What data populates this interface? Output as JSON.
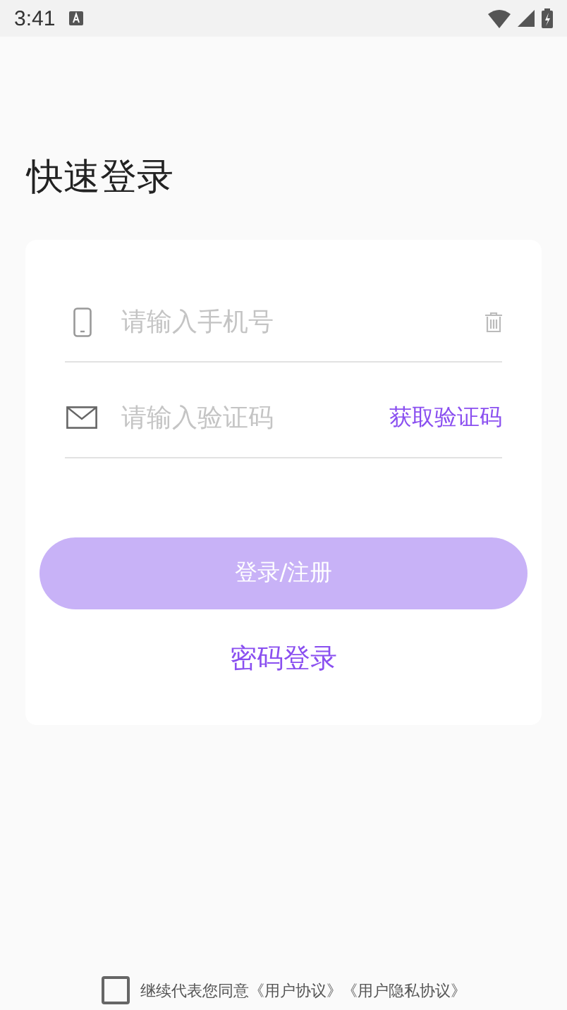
{
  "status_bar": {
    "time": "3:41"
  },
  "title": "快速登录",
  "phone_field": {
    "placeholder": "请输入手机号"
  },
  "code_field": {
    "placeholder": "请输入验证码",
    "action": "获取验证码"
  },
  "submit_button": {
    "label": "登录/注册",
    "disabled": true
  },
  "switch_link": "密码登录",
  "agreement": {
    "checked": false,
    "text": "继续代表您同意《用户协议》《用户隐私协议》"
  }
}
